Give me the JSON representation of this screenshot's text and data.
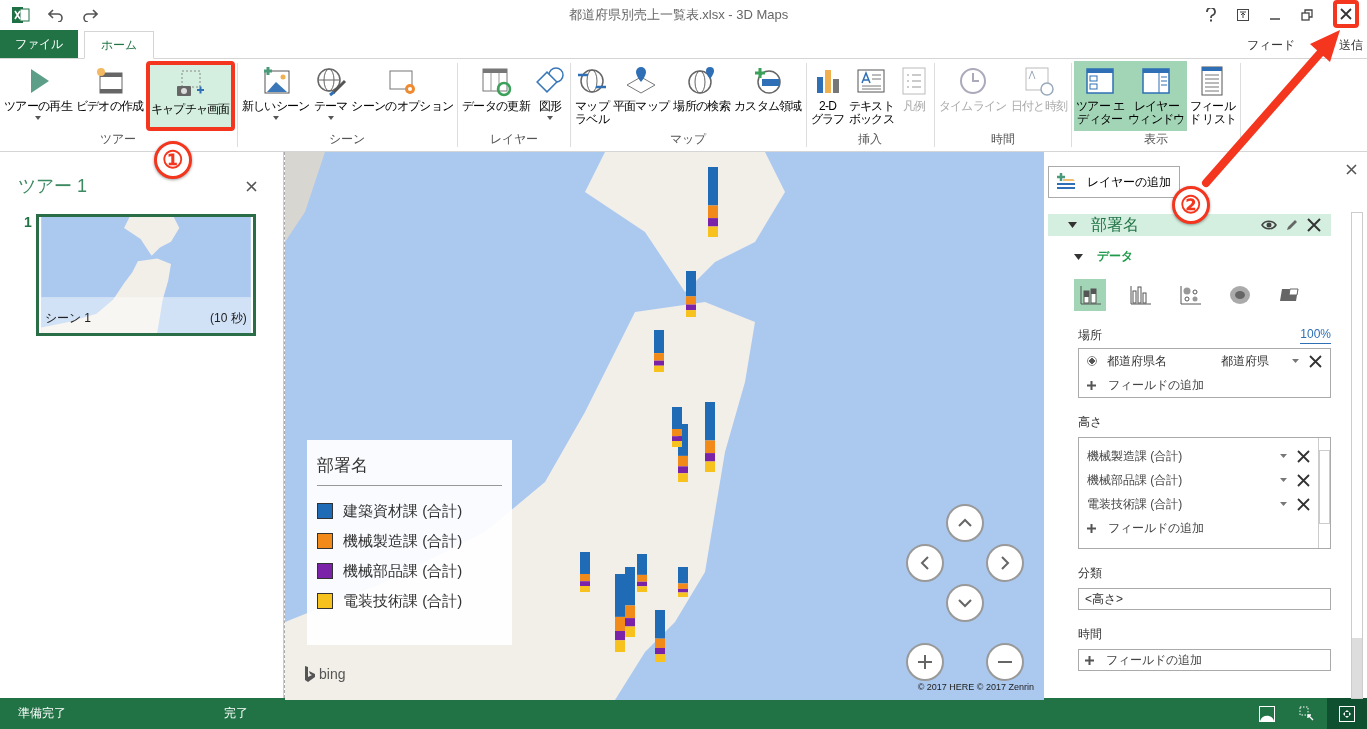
{
  "window": {
    "title": "都道府県別売上一覧表.xlsx - 3D Maps",
    "close_highlighted": true
  },
  "tabs": [
    {
      "label": "ファイル",
      "kind": "file",
      "selected": false
    },
    {
      "label": "ホーム",
      "kind": "normal",
      "selected": true
    }
  ],
  "feedback": [
    "フィード",
    "送信"
  ],
  "ribbon": {
    "groups": [
      {
        "label": "ツアー",
        "buttons": [
          {
            "lines": [
              "ツアーの再生"
            ],
            "kind": "play",
            "dropdown": true,
            "selected": false,
            "disabled": false,
            "highlighted": false
          },
          {
            "lines": [
              "ビデオの作成"
            ],
            "kind": "video",
            "dropdown": false,
            "selected": false,
            "disabled": false,
            "highlighted": false
          },
          {
            "lines": [
              "キャプチャ画面"
            ],
            "kind": "capture",
            "dropdown": false,
            "selected": true,
            "disabled": false,
            "highlighted": true
          }
        ]
      },
      {
        "label": "シーン",
        "buttons": [
          {
            "lines": [
              "新しいシーン"
            ],
            "kind": "scene",
            "dropdown": true,
            "selected": false,
            "disabled": false,
            "highlighted": false
          },
          {
            "lines": [
              "テーマ"
            ],
            "kind": "theme",
            "dropdown": true,
            "selected": false,
            "disabled": false,
            "highlighted": false
          },
          {
            "lines": [
              "シーンのオプション"
            ],
            "kind": "options",
            "dropdown": false,
            "selected": false,
            "disabled": false,
            "highlighted": false
          }
        ]
      },
      {
        "label": "レイヤー",
        "buttons": [
          {
            "lines": [
              "データの更新"
            ],
            "kind": "refresh",
            "dropdown": false,
            "selected": false,
            "disabled": false,
            "highlighted": false
          },
          {
            "lines": [
              "図形"
            ],
            "kind": "shape",
            "dropdown": true,
            "selected": false,
            "disabled": false,
            "highlighted": false
          }
        ]
      },
      {
        "label": "マップ",
        "buttons": [
          {
            "lines": [
              "マップ",
              "ラベル"
            ],
            "kind": "maplabel",
            "dropdown": false,
            "selected": false,
            "disabled": false,
            "highlighted": false
          },
          {
            "lines": [
              "平面マップ"
            ],
            "kind": "flatmap",
            "dropdown": false,
            "selected": false,
            "disabled": false,
            "highlighted": false
          },
          {
            "lines": [
              "場所の検索"
            ],
            "kind": "findplace",
            "dropdown": false,
            "selected": false,
            "disabled": false,
            "highlighted": false
          },
          {
            "lines": [
              "カスタム領域"
            ],
            "kind": "region",
            "dropdown": false,
            "selected": false,
            "disabled": false,
            "highlighted": false
          }
        ]
      },
      {
        "label": "挿入",
        "buttons": [
          {
            "lines": [
              "2-D",
              "グラフ"
            ],
            "kind": "chart",
            "dropdown": false,
            "selected": false,
            "disabled": false,
            "highlighted": false
          },
          {
            "lines": [
              "テキスト",
              "ボックス"
            ],
            "kind": "textbox",
            "dropdown": false,
            "selected": false,
            "disabled": false,
            "highlighted": false
          },
          {
            "lines": [
              "凡例"
            ],
            "kind": "legend",
            "dropdown": false,
            "selected": false,
            "disabled": true,
            "highlighted": false
          }
        ]
      },
      {
        "label": "時間",
        "buttons": [
          {
            "lines": [
              "タイムライン"
            ],
            "kind": "timeline",
            "dropdown": false,
            "selected": false,
            "disabled": true,
            "highlighted": false
          },
          {
            "lines": [
              "日付と時刻"
            ],
            "kind": "datetime",
            "dropdown": false,
            "selected": false,
            "disabled": true,
            "highlighted": false
          }
        ]
      },
      {
        "label": "表示",
        "buttons": [
          {
            "lines": [
              "ツアー エ",
              "ディター"
            ],
            "kind": "toureditor",
            "dropdown": false,
            "selected": true,
            "disabled": false,
            "highlighted": false
          },
          {
            "lines": [
              "レイヤー",
              "ウィンドウ"
            ],
            "kind": "layerpane",
            "dropdown": false,
            "selected": true,
            "disabled": false,
            "highlighted": false
          },
          {
            "lines": [
              "フィール",
              "ド リスト"
            ],
            "kind": "fieldlist",
            "dropdown": false,
            "selected": false,
            "disabled": false,
            "highlighted": false
          }
        ]
      }
    ]
  },
  "tour_panel": {
    "title": "ツアー 1",
    "scenes": [
      {
        "number": "1",
        "name": "シーン 1",
        "duration": "(10 秒)",
        "selected": true
      }
    ]
  },
  "map": {
    "legend": {
      "title": "部署名",
      "items": [
        {
          "label": "建築資材課 (合計)",
          "color": "#1f6bb5"
        },
        {
          "label": "機械製造課 (合計)",
          "color": "#f28a1a"
        },
        {
          "label": "機械部品課 (合計)",
          "color": "#7a22a8"
        },
        {
          "label": "電装技術課 (合計)",
          "color": "#f7c21d"
        }
      ]
    },
    "logo": "bing",
    "attribution": "© 2017 HERE  © 2017 Zenrin"
  },
  "layer_pane": {
    "add_layer": "レイヤーの追加",
    "layer": {
      "name": "部署名",
      "expanded": true
    },
    "section": {
      "name": "データ",
      "expanded": true
    },
    "viz_types": [
      {
        "kind": "stacked",
        "selected": true
      },
      {
        "kind": "clustered",
        "selected": false
      },
      {
        "kind": "bubble",
        "selected": false
      },
      {
        "kind": "heat",
        "selected": false
      },
      {
        "kind": "region",
        "selected": false
      }
    ],
    "location": {
      "label": "場所",
      "zoom": "100%",
      "fields": [
        {
          "name": "都道府県名",
          "type": "都道府県",
          "selected": true
        }
      ],
      "add": "フィールドの追加"
    },
    "height": {
      "label": "高さ",
      "fields": [
        {
          "name": "機械製造課 (合計)"
        },
        {
          "name": "機械部品課 (合計)"
        },
        {
          "name": "電装技術課 (合計)"
        }
      ],
      "add": "フィールドの追加"
    },
    "category": {
      "label": "分類",
      "value": "<高さ>"
    },
    "time": {
      "label": "時間",
      "add": "フィールドの追加"
    }
  },
  "status_bar": {
    "left": "準備完了",
    "middle": "完了",
    "views": [
      {
        "kind": "terrain",
        "selected": false
      },
      {
        "kind": "select",
        "selected": false
      },
      {
        "kind": "navigate",
        "selected": true
      }
    ]
  },
  "annotations": [
    "①",
    "②"
  ]
}
